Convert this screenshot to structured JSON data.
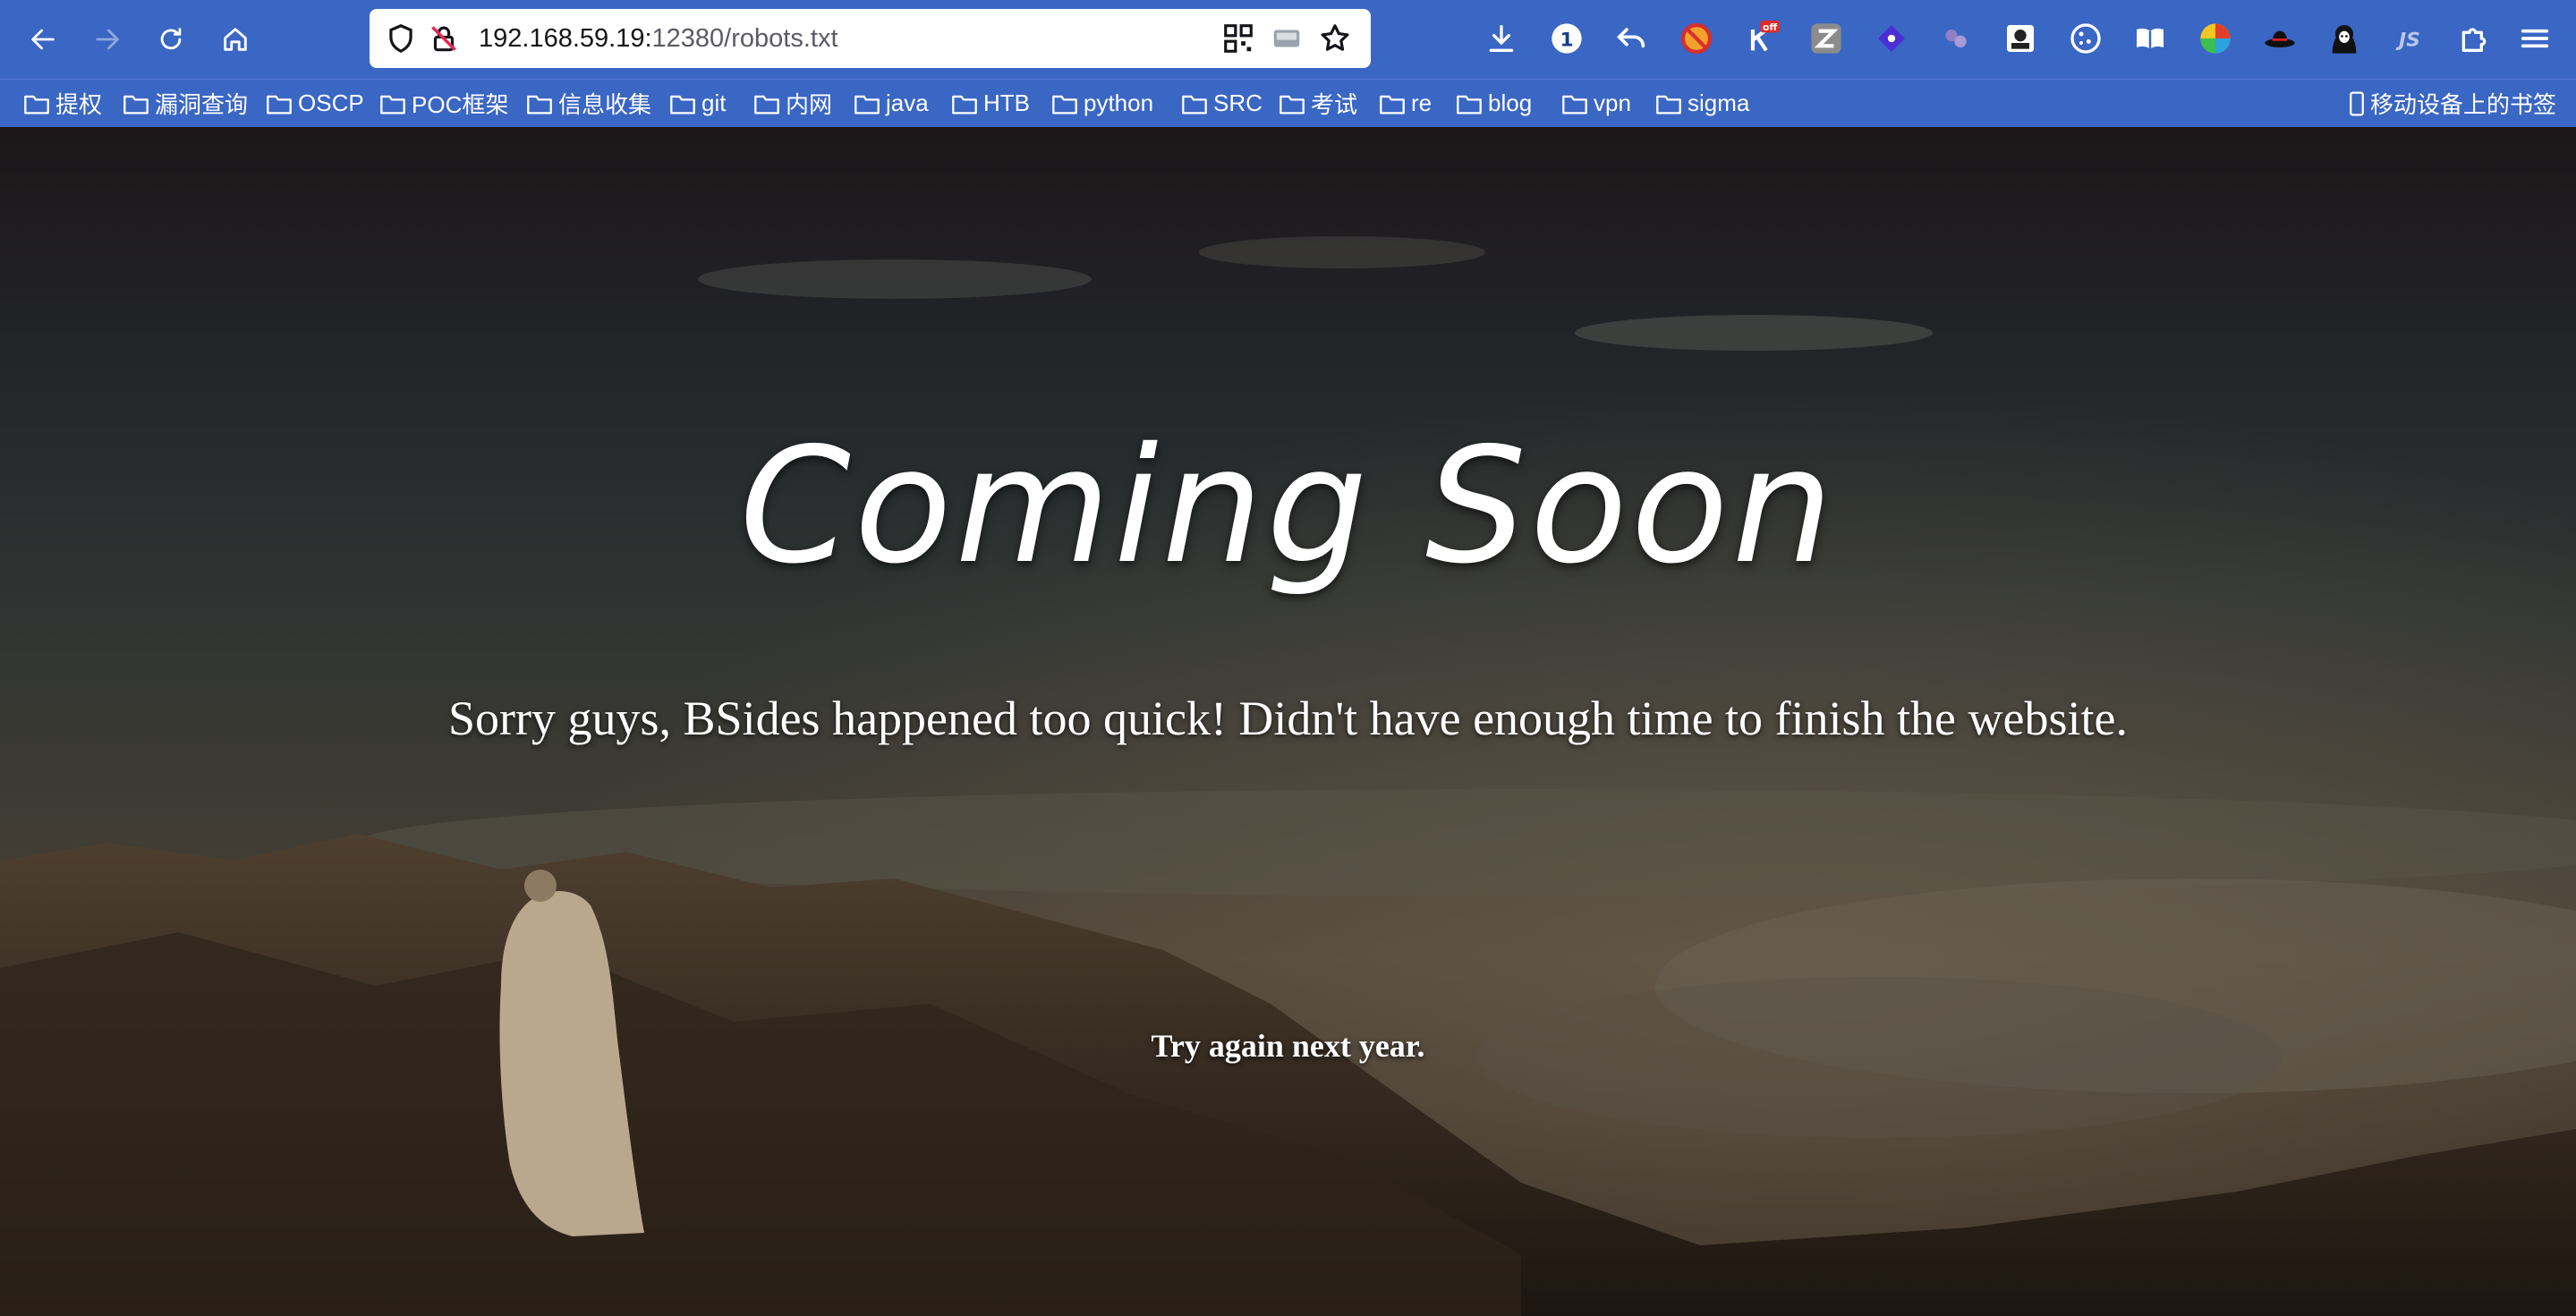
{
  "browser": {
    "url": {
      "host": "192.168.59.19:",
      "port": "12380",
      "path": "/robots.txt"
    },
    "nav_icons": [
      "back-icon",
      "forward-icon",
      "reload-icon",
      "home-icon"
    ],
    "urlbar_icons": [
      "shield-icon",
      "insecure-lock-icon",
      "qr-code-icon",
      "screenshot-icon",
      "bookmark-star-icon"
    ],
    "extensions": [
      "download-icon",
      "password-manager-icon",
      "undo-icon",
      "block-icon",
      "off-extension-icon",
      "zotero-icon",
      "ext-diamond-icon",
      "ext-dots-icon",
      "ext-portrait-icon",
      "cookie-icon",
      "reader-icon",
      "color-picker-icon",
      "hat-icon",
      "hacker-icon",
      "js-icon",
      "extensions-puzzle-icon",
      "menu-icon"
    ],
    "off_badge": "off",
    "password_badge": "1",
    "colors": {
      "toolbar": "#3a66c4",
      "url_bg": "#ffffff"
    }
  },
  "bookmarks": {
    "items": [
      {
        "label": "提权"
      },
      {
        "label": "漏洞查询"
      },
      {
        "label": "OSCP"
      },
      {
        "label": "POC框架"
      },
      {
        "label": "信息收集"
      },
      {
        "label": "git"
      },
      {
        "label": "内网"
      },
      {
        "label": "java"
      },
      {
        "label": "HTB"
      },
      {
        "label": "python"
      },
      {
        "label": "SRC"
      },
      {
        "label": "考试"
      },
      {
        "label": "re"
      },
      {
        "label": "blog"
      },
      {
        "label": "vpn"
      },
      {
        "label": "sigma"
      }
    ],
    "mobile": "移动设备上的书签"
  },
  "page": {
    "headline": "Coming Soon",
    "subheadline": "Sorry guys, BSides happened too quick! Didn't have enough time to finish the website.",
    "footer_text": "Try again next year."
  }
}
